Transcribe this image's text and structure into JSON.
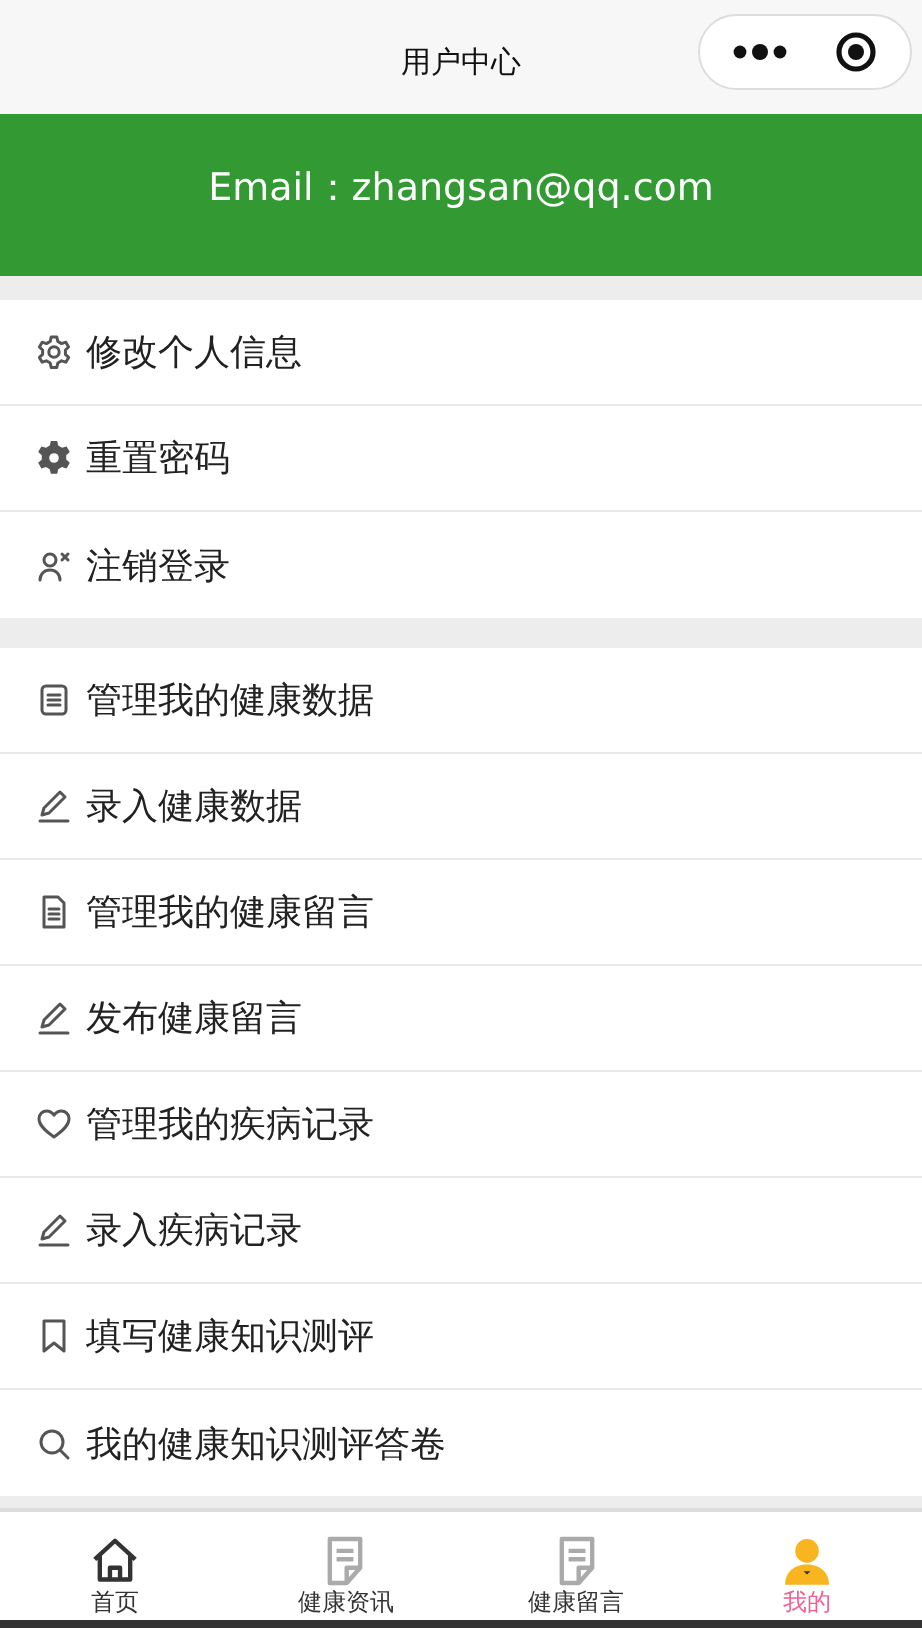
{
  "window": {
    "title": "用户中心"
  },
  "profile": {
    "email": "Email：zhangsan@qq.com"
  },
  "menu_groups": [
    {
      "items": [
        {
          "kind": "gear-outline",
          "label": "修改个人信息"
        },
        {
          "kind": "gear",
          "label": "重置密码"
        },
        {
          "kind": "user-x",
          "label": "注销登录"
        }
      ]
    },
    {
      "items": [
        {
          "kind": "list",
          "label": "管理我的健康数据"
        },
        {
          "kind": "pencil",
          "label": "录入健康数据"
        },
        {
          "kind": "document",
          "label": "管理我的健康留言"
        },
        {
          "kind": "pencil",
          "label": "发布健康留言"
        },
        {
          "kind": "heart",
          "label": "管理我的疾病记录"
        },
        {
          "kind": "pencil",
          "label": "录入疾病记录"
        },
        {
          "kind": "bookmark",
          "label": "填写健康知识测评"
        },
        {
          "kind": "search",
          "label": "我的健康知识测评答卷"
        }
      ]
    }
  ],
  "tab_bar": [
    {
      "kind": "home",
      "label": "首页",
      "selected": false
    },
    {
      "kind": "note",
      "label": "健康资讯",
      "selected": false
    },
    {
      "kind": "note",
      "label": "健康留言",
      "selected": false
    },
    {
      "kind": "user",
      "label": "我的",
      "selected": true
    }
  ]
}
